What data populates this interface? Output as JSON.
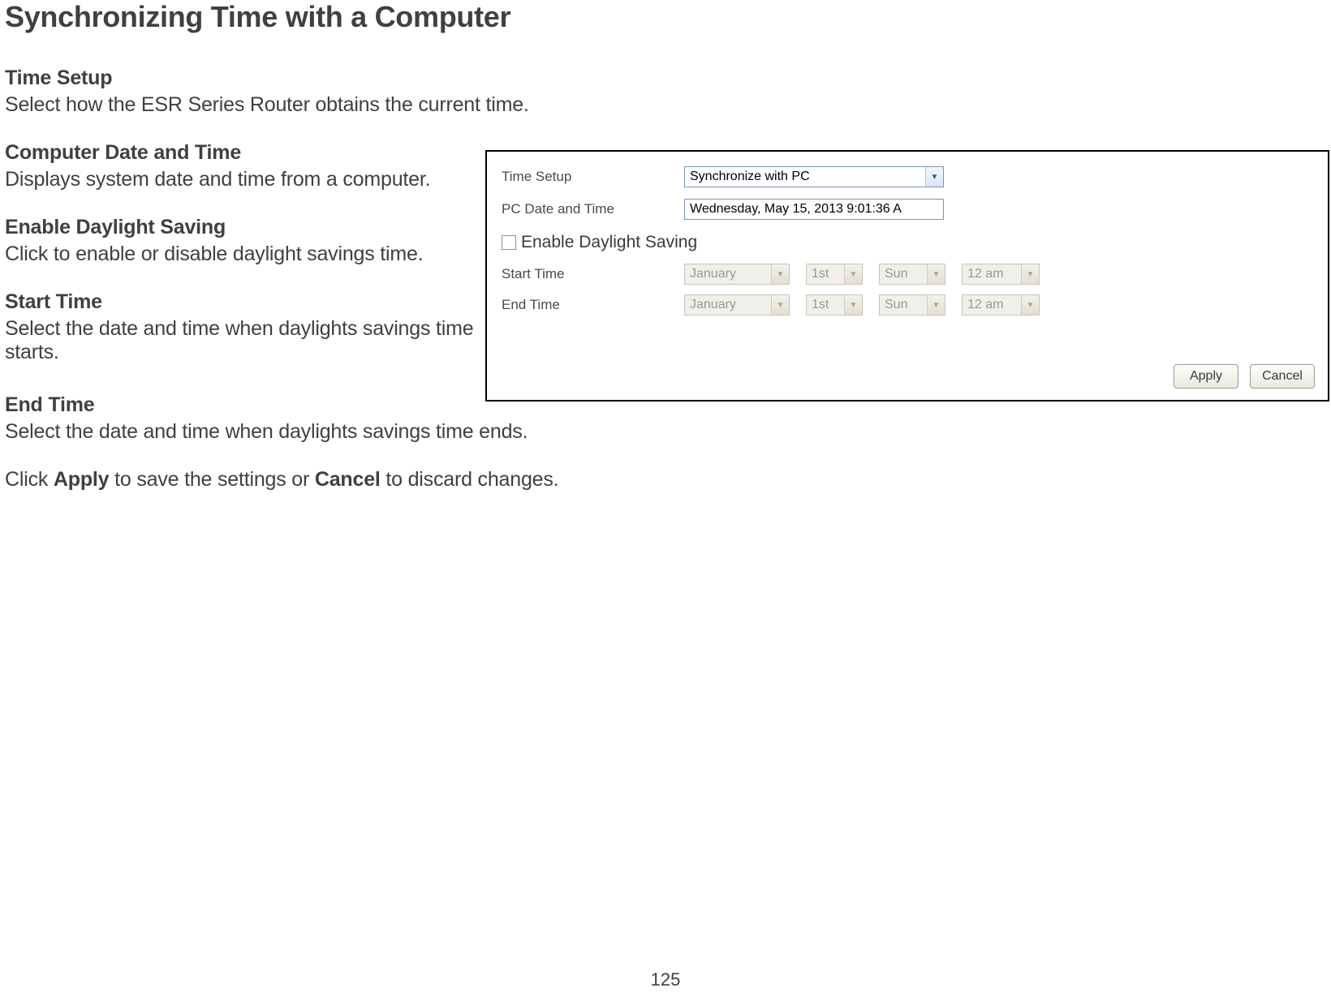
{
  "doc": {
    "title": "Synchronizing Time with a Computer",
    "page_number": "125",
    "sections": {
      "time_setup": {
        "heading": "Time Setup",
        "body": "Select how the ESR Series Router obtains the current time."
      },
      "computer_date_time": {
        "heading": "Computer Date and Time",
        "body": "Displays system date and time from a computer."
      },
      "enable_daylight": {
        "heading": "Enable Daylight Saving",
        "body": "Click to enable or disable daylight savings time."
      },
      "start_time": {
        "heading": "Start Time",
        "body": "Select the date and time when daylights savings time starts."
      },
      "end_time": {
        "heading": "End Time",
        "body": "Select the date and time when daylights savings time ends."
      },
      "footer": {
        "prefix": "Click ",
        "apply_word": "Apply",
        "mid": " to save the settings or ",
        "cancel_word": "Cancel",
        "suffix": " to discard changes."
      }
    }
  },
  "panel": {
    "time_setup_label": "Time Setup",
    "time_setup_value": "Synchronize with PC",
    "pc_date_label": "PC Date and Time",
    "pc_date_value": "Wednesday, May 15, 2013 9:01:36 A",
    "daylight_checkbox_label": "Enable Daylight Saving",
    "start_time_label": "Start Time",
    "end_time_label": "End Time",
    "start": {
      "month": "January",
      "day": "1st",
      "dow": "Sun",
      "hour": "12 am"
    },
    "end": {
      "month": "January",
      "day": "1st",
      "dow": "Sun",
      "hour": "12 am"
    },
    "buttons": {
      "apply": "Apply",
      "cancel": "Cancel"
    }
  }
}
